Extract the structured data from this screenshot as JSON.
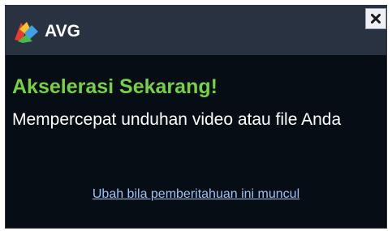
{
  "app": {
    "brand": "AVG"
  },
  "notification": {
    "headline": "Akselerasi Sekarang!",
    "message": "Mempercepat unduhan video atau file Anda",
    "settings_link": "Ubah bila pemberitahuan ini muncul"
  },
  "icons": {
    "logo": "avg-logo-icon",
    "close": "close-icon"
  },
  "colors": {
    "background": "#070d15",
    "titlebar": "#293241",
    "headline": "#76d146",
    "message": "#ffffff",
    "link": "#9dc3f0"
  }
}
